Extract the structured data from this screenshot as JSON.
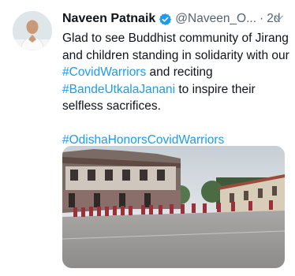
{
  "tweet": {
    "author_name": "Naveen Patnaik",
    "handle": "@Naveen_O...",
    "separator": "·",
    "time": "2d",
    "text_part1": "Glad to see Buddhist community of Jirang and children standing in solidarity with our ",
    "hashtag1": "#CovidWarriors",
    "text_part2": " and reciting ",
    "hashtag2": "#BandeUtkalaJanani",
    "text_part3": " to inspire their selfless sacrifices.",
    "hashtag3": "#OdishaHonorsCovidWarriors"
  },
  "colors": {
    "link": "#1d9bf0",
    "verified_badge": "#1d9bf0",
    "text_primary": "#0f1419",
    "text_secondary": "#536471"
  },
  "icons": {
    "verified": "verified-badge-icon",
    "more": "chevron-down-icon"
  }
}
